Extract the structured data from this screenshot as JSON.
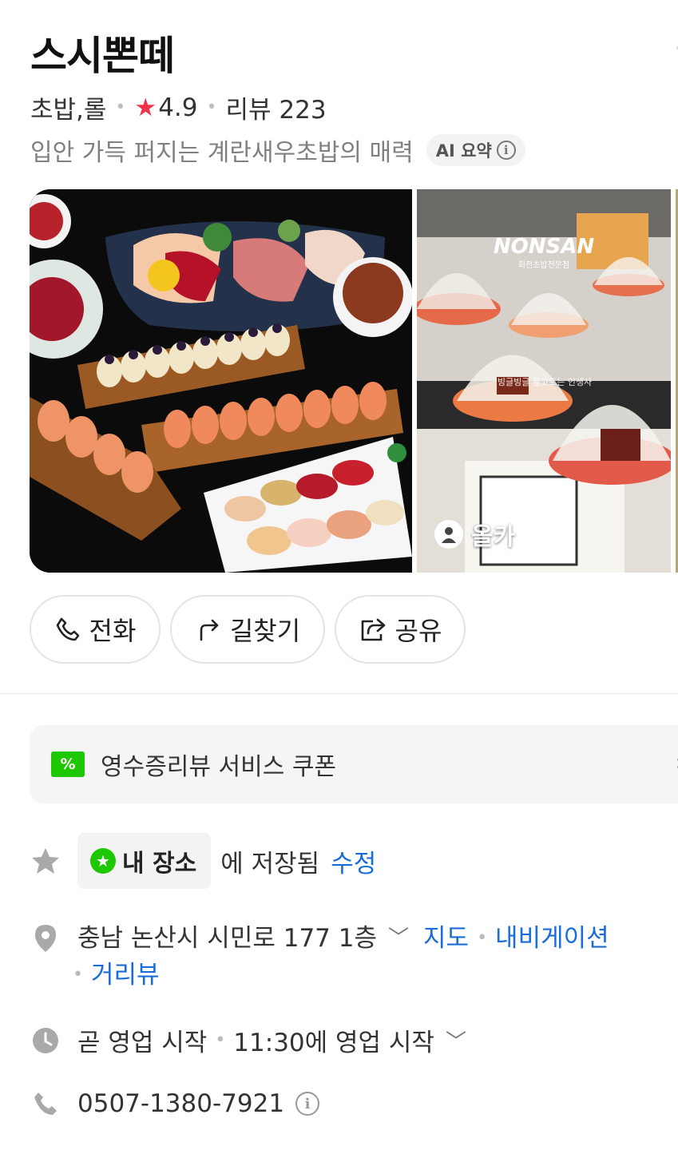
{
  "place": {
    "name": "스시뽄떼",
    "category": "초밥,롤",
    "rating": "4.9",
    "review_label": "리뷰 223",
    "summary": "입안 가득 퍼지는 계란새우초밥의 매력",
    "ai_badge": "AI 요약"
  },
  "gallery": {
    "photo2_sign": "NONSAN",
    "photo2_subsign": "회전초밥전문점",
    "photo2_caption": "빙글빙글 돌고도는 인생사",
    "credit": "올카"
  },
  "actions": [
    {
      "label": "전화",
      "icon": "phone-icon"
    },
    {
      "label": "길찾기",
      "icon": "directions-icon"
    },
    {
      "label": "공유",
      "icon": "share-icon"
    }
  ],
  "coupon": {
    "label": "영수증리뷰 서비스 쿠폰",
    "icon_text": "%"
  },
  "my_place": {
    "chip_label": "내 장소",
    "saved_text": "에 저장됨",
    "edit_link": "수정"
  },
  "address": {
    "text": "충남 논산시 시민로 177 1층",
    "map_link": "지도",
    "nav_link": "내비게이션",
    "street_link": "거리뷰"
  },
  "hours": {
    "status": "곧 영업 시작",
    "detail": "11:30에 영업 시작"
  },
  "phone": {
    "number": "0507-1380-7921"
  },
  "colors": {
    "accent_link": "#1a6dd9",
    "star": "#f0324b",
    "naver_green": "#1ec800"
  }
}
